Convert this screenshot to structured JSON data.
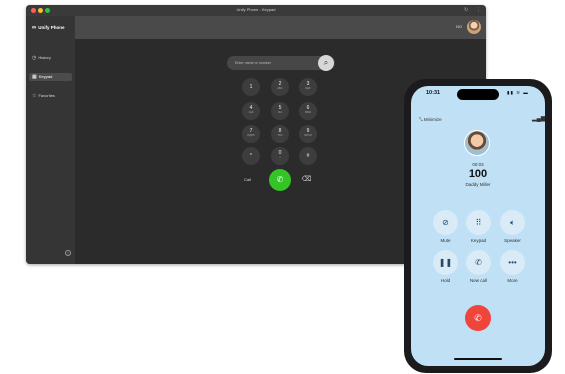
{
  "desktop": {
    "window_title": "Unify Phone - Keypad",
    "app_name": "Unify Phone",
    "sidebar": {
      "items": [
        {
          "label": "History",
          "icon": "clock-icon"
        },
        {
          "label": "Keypad",
          "icon": "keypad-icon"
        },
        {
          "label": "Favorites",
          "icon": "star-icon"
        }
      ],
      "help_label": "?"
    },
    "header": {
      "status_text": "NO"
    },
    "search": {
      "placeholder": "Enter name or number"
    },
    "keypad": [
      {
        "digit": "1",
        "letters": ""
      },
      {
        "digit": "2",
        "letters": "ABC"
      },
      {
        "digit": "3",
        "letters": "DEF"
      },
      {
        "digit": "4",
        "letters": "GHI"
      },
      {
        "digit": "5",
        "letters": "JKL"
      },
      {
        "digit": "6",
        "letters": "MNO"
      },
      {
        "digit": "7",
        "letters": "PQRS"
      },
      {
        "digit": "8",
        "letters": "TUV"
      },
      {
        "digit": "9",
        "letters": "WXYZ"
      },
      {
        "digit": "*",
        "letters": ""
      },
      {
        "digit": "0",
        "letters": "+"
      },
      {
        "digit": "#",
        "letters": ""
      }
    ],
    "call_label": "Call",
    "colors": {
      "call_button": "#34c426",
      "background": "#2b2b2b"
    }
  },
  "phone": {
    "status_time": "10:31",
    "minimize_label": "Minimize",
    "duration": "00:03",
    "number": "100",
    "contact_name": "Daddy Miller",
    "actions": [
      {
        "label": "Mute",
        "icon": "mic-off-icon"
      },
      {
        "label": "Keypad",
        "icon": "keypad-icon"
      },
      {
        "label": "Speaker",
        "icon": "speaker-icon"
      },
      {
        "label": "Hold",
        "icon": "pause-icon"
      },
      {
        "label": "New call",
        "icon": "phone-plus-icon"
      },
      {
        "label": "More",
        "icon": "more-icon"
      }
    ],
    "colors": {
      "screen": "#bfe0f5",
      "end_call": "#f0453a"
    }
  }
}
